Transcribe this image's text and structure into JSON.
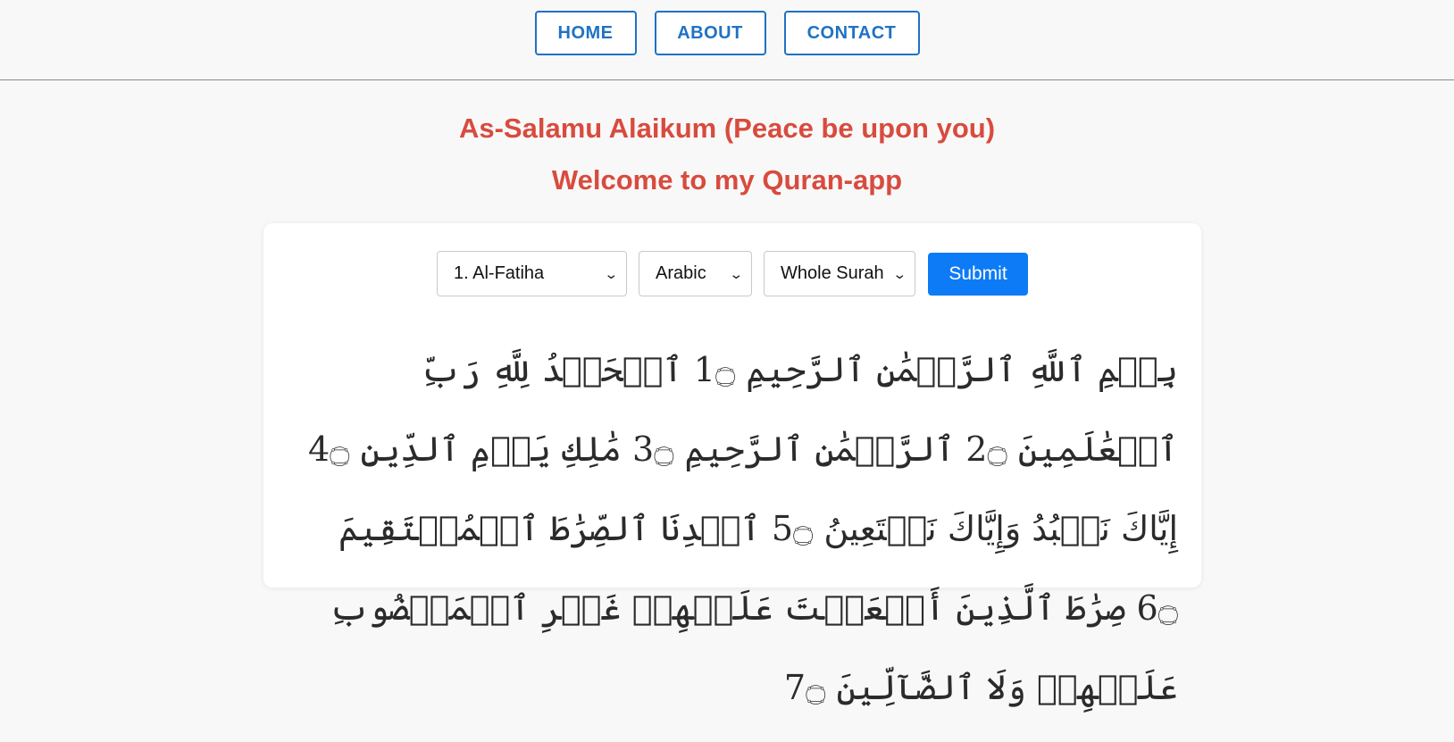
{
  "nav": {
    "home": "HOME",
    "about": "ABOUT",
    "contact": "CONTACT"
  },
  "headings": {
    "greeting": "As-Salamu Alaikum (Peace be upon you)",
    "welcome": "Welcome to my Quran-app"
  },
  "controls": {
    "surah": "1. Al-Fatiha",
    "language": "Arabic",
    "range": "Whole Surah",
    "submit": "Submit"
  },
  "verses": [
    {
      "text": "بِسۡمِ ٱللَّهِ ٱلرَّحۡمَٰنِ ٱلرَّحِيمِ",
      "num": "1"
    },
    {
      "text": "ٱلۡحَمۡدُ لِلَّهِ رَبِّ ٱلۡعَٰلَمِينَ",
      "num": "2"
    },
    {
      "text": "ٱلرَّحۡمَٰنِ ٱلرَّحِيمِ",
      "num": "3"
    },
    {
      "text": "مَٰلِكِ يَوۡمِ ٱلدِّينِ",
      "num": "4"
    },
    {
      "text": "إِيَّاكَ نَعۡبُدُ وَإِيَّاكَ نَسۡتَعِينُ",
      "num": "5"
    },
    {
      "text": "ٱهۡدِنَا ٱلصِّرَٰطَ ٱلۡمُسۡتَقِيمَ",
      "num": "6"
    },
    {
      "text": "صِرَٰطَ ٱلَّذِينَ أَنۡعَمۡتَ عَلَيۡهِمۡ غَيۡرِ ٱلۡمَغۡضُوبِ عَلَيۡهِمۡ وَلَا ٱلضَّآلِّينَ",
      "num": "7"
    }
  ],
  "colors": {
    "nav_blue": "#1f72c4",
    "heading_red": "#d84b3e",
    "submit_blue": "#0d7bf6"
  }
}
